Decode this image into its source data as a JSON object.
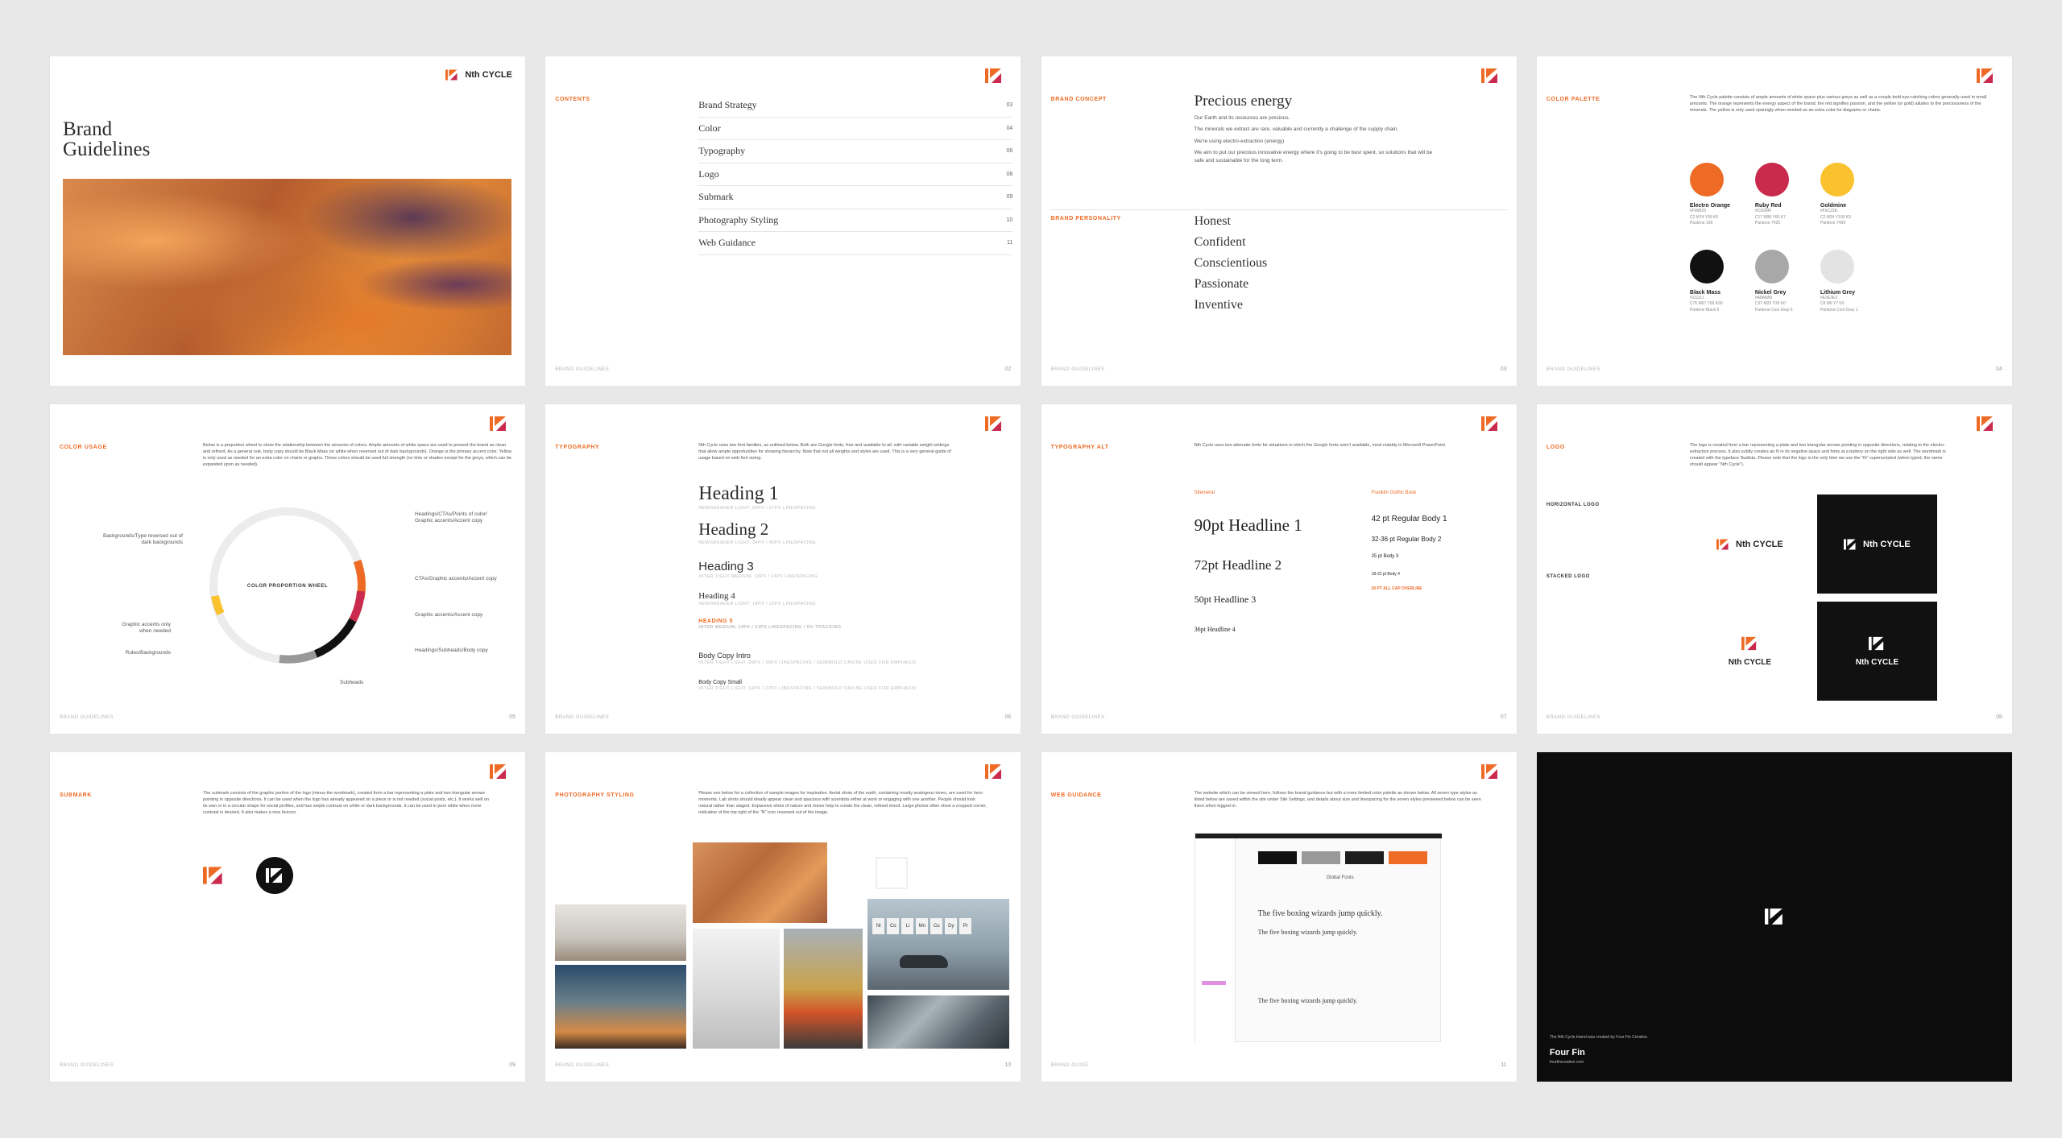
{
  "brand": {
    "name": "Nth CYCLE",
    "accent": "#ee6b25",
    "red": "#c92a4d",
    "dark": "#111111"
  },
  "footer": "BRAND GUIDELINES",
  "slide1": {
    "title_line1": "Brand",
    "title_line2": "Guidelines"
  },
  "contents": {
    "label": "CONTENTS",
    "items": [
      {
        "name": "Brand Strategy",
        "page": "03"
      },
      {
        "name": "Color",
        "page": "04"
      },
      {
        "name": "Typography",
        "page": "06"
      },
      {
        "name": "Logo",
        "page": "08"
      },
      {
        "name": "Submark",
        "page": "09"
      },
      {
        "name": "Photography Styling",
        "page": "10"
      },
      {
        "name": "Web Guidance",
        "page": "11"
      }
    ],
    "pnum": "02"
  },
  "concept": {
    "label": "BRAND CONCEPT",
    "title": "Precious energy",
    "p1": "Our Earth and its resources are precious.",
    "p2": "The minerals we extract are rare, valuable and currently a challenge of the supply chain.",
    "p3": "We're using electro-extraction (energy)",
    "p4": "We aim to put our precious innovative energy where it's going to be best spent, so solutions that will be safe and sustainable for the long term.",
    "label2": "BRAND PERSONALITY",
    "traits": [
      "Honest",
      "Confident",
      "Conscientious",
      "Passionate",
      "Inventive"
    ],
    "pnum": "03"
  },
  "palette": {
    "label": "COLOR PALETTE",
    "intro": "The Nth Cycle palette consists of ample amounts of white space plus various greys as well as a couple bold eye-catching colors generally used in small amounts. The orange represents the energy aspect of the brand, the red signifies passion, and the yellow (or gold) alludes to the preciousness of the minerals. The yellow is only used sparingly when needed as an extra color for diagrams or charts.",
    "colors": [
      {
        "name": "Electro Orange",
        "hex": "#EE6B25",
        "d1": "#F06B25",
        "d2": "C2 M74 Y99 K0",
        "d3": "Pantone 166",
        "color": "#ee6b25"
      },
      {
        "name": "Ruby Red",
        "hex": "#C92A4D",
        "d1": "#C9264F",
        "d2": "C17 M98 Y60 K7",
        "d3": "Pantone 7425",
        "color": "#c92a4d"
      },
      {
        "name": "Goldmine",
        "hex": "#F9C22E",
        "d1": "#F9C22E",
        "d2": "C2 M24 Y100 K0",
        "d3": "Pantone 7409",
        "color": "#f9c22e"
      },
      {
        "name": "Black Mass",
        "hex": "#111111",
        "d1": "#111111",
        "d2": "C75 M67 Y66 K90",
        "d3": "Pantone Black 6",
        "color": "#111111"
      },
      {
        "name": "Nickel Grey",
        "hex": "#A8A8A8",
        "d1": "#A8A8A8",
        "d2": "C37 M29 Y30 K0",
        "d3": "Pantone Cool Gray 6",
        "color": "#a8a8a8"
      },
      {
        "name": "Lithium Grey",
        "hex": "#E3E3E3",
        "d1": "#E3E3E3",
        "d2": "C8 M6 Y7 K0",
        "d3": "Pantone Cool Gray 1",
        "color": "#e3e3e3"
      }
    ],
    "pnum": "04"
  },
  "usage": {
    "label": "COLOR USAGE",
    "intro": "Below is a proportion wheel to show the relationship between the amounts of colors. Ample amounts of white space are used to present the brand as clean and refined. As a general rule, body copy should be Black Mass (or white when reversed out of dark backgrounds). Orange is the primary accent color. Yellow is only used as needed for an extra color on charts or graphs. These colors should be used full strength (no tints or shades except for the greys, which can be expanded upon as needed).",
    "center": "COLOR PROPORTION WHEEL",
    "labels": {
      "a": "Backgrounds/Type reversed out of dark backgrounds",
      "b": "Headings/CTAs/Points of color/ Graphic accents/Accent copy",
      "c": "CTAs/Graphic accents/Accent copy",
      "d": "Graphic accents/Accent copy",
      "e": "Headings/Subheads/Body copy",
      "f": "Graphic accents only when needed",
      "g": "Rules/Backgrounds",
      "h": "Subheads"
    },
    "pnum": "05"
  },
  "typography": {
    "label": "TYPOGRAPHY",
    "intro": "Nth Cycle uses two font families, as outlined below. Both are Google fonts, free and available to all, with variable weight settings that allow ample opportunities for showing hierarchy. Note that not all weights and styles are used. This is a very general guide of usage based on web font sizing.",
    "h1": "Heading 1",
    "h1s": "NEWSREADER LIGHT, 50PX / 57PX LINESPACING",
    "h2": "Heading 2",
    "h2s": "NEWSREADER LIGHT, 34PX / 40PX LINESPACING",
    "h3": "Heading 3",
    "h3s": "INTER TIGHT MEDIUM, 18PX / 24PX LINESPACING",
    "h4": "Heading 4",
    "h4s": "NEWSREADER LIGHT, 18PX / 23PX LINESPACING",
    "h5": "HEADING 5",
    "h5s": "INTER MEDIUM, 14PX / 21PX LINESPACING / 5% TRACKING",
    "b1": "Body Copy Intro",
    "b1s": "INTER TIGHT LIGHT, 20PX / 28PX LINESPACING / SEMIBOLD CAN BE USED FOR EMPHASIS",
    "b2": "Body Copy Small",
    "b2s": "INTER TIGHT LIGHT, 14PX / 22PX LINESPACING / SEMIBOLD CAN BE USED FOR EMPHASIS",
    "pnum": "06"
  },
  "typealt": {
    "label": "TYPOGRAPHY ALT",
    "intro": "Nth Cycle uses two alternate fonts for situations in which the Google fonts aren't available, most notably in Microsoft PowerPoint.",
    "col1": "Sitemeral",
    "col2": "Franklin Gothic Book",
    "l1": "90pt Headline 1",
    "l2": "72pt Headline 2",
    "l3": "50pt Headline 3",
    "l4": "36pt Headline 4",
    "r1": "42 pt Regular Body 1",
    "r2": "32-36 pt Regular Body 2",
    "r3": "25 pt Body 3",
    "r4": "18-22 pt Body 4",
    "r5": "20 PT ALL CAP OVERLINE",
    "pnum": "07"
  },
  "logo": {
    "label": "LOGO",
    "intro": "The logo is created from a bar representing a plate and two triangular arrows pointing in opposite directions, relating to the electro-extraction process. It also subtly creates an N in its negative space and hints at a battery on the right side as well. The wordmark is created with the typeface Nudista. Please note that the logo is the only time we use the \"th\" superscripted (when typed, the name should appear \"Nth Cycle\").",
    "h": "HORIZONTAL LOGO",
    "s": "STACKED LOGO",
    "word": "Nᵀᴴ CYCLE",
    "pnum": "08"
  },
  "submark": {
    "label": "SUBMARK",
    "intro": "The submark consists of the graphic portion of the logo (minus the wordmark), created from a bar representing a plate and two triangular arrows pointing in opposite directions. It can be used when the logo has already appeared on a piece or is not needed (social posts, etc.). It works well on its own or in a circular shape for social profiles, and has ample contrast on white or dark backgrounds. It can be used in pure white when more contrast is desired. It also makes a nice favicon.",
    "pnum": "09"
  },
  "photo": {
    "label": "PHOTOGRAPHY STYLING",
    "intro": "Please see below for a collection of sample images for inspiration. Aerial shots of the earth, containing mostly analogous tones, are used for hero moments. Lab shots should ideally appear clean and spacious with scientists either at work or engaging with one another. People should look natural rather than staged. Expansive shots of nature and mines help to create the clean, refined mood. Large photos often show a cropped corner, indicative of the top right of the \"N\" icon reversed out of the image.",
    "elements": [
      "Ni",
      "Co",
      "Li",
      "Mn",
      "Cu",
      "Dy",
      "Pr"
    ],
    "pnum": "10"
  },
  "web": {
    "label": "WEB GUIDANCE",
    "intro": "The website which can be viewed here, follows the brand guidance but with a more limited color palette as shown below. All seven type styles as listed below are saved within the site under Site Settings, and details about size and linespacing for the seven styles previewed below can be seen there when logged in.",
    "global": "Global Fonts",
    "s1": "The five boxing wizards jump quickly.",
    "s2": "The five boxing wizards jump quickly.",
    "s3": "The five boxing wizards jump quickly.",
    "foot": "BRAND GUIDE",
    "pnum": "11"
  },
  "closing": {
    "credit": "The Nth Cycle brand was created by Four Fin Creative.",
    "agency": "Four Fin",
    "url": "fourfincreative.com"
  }
}
